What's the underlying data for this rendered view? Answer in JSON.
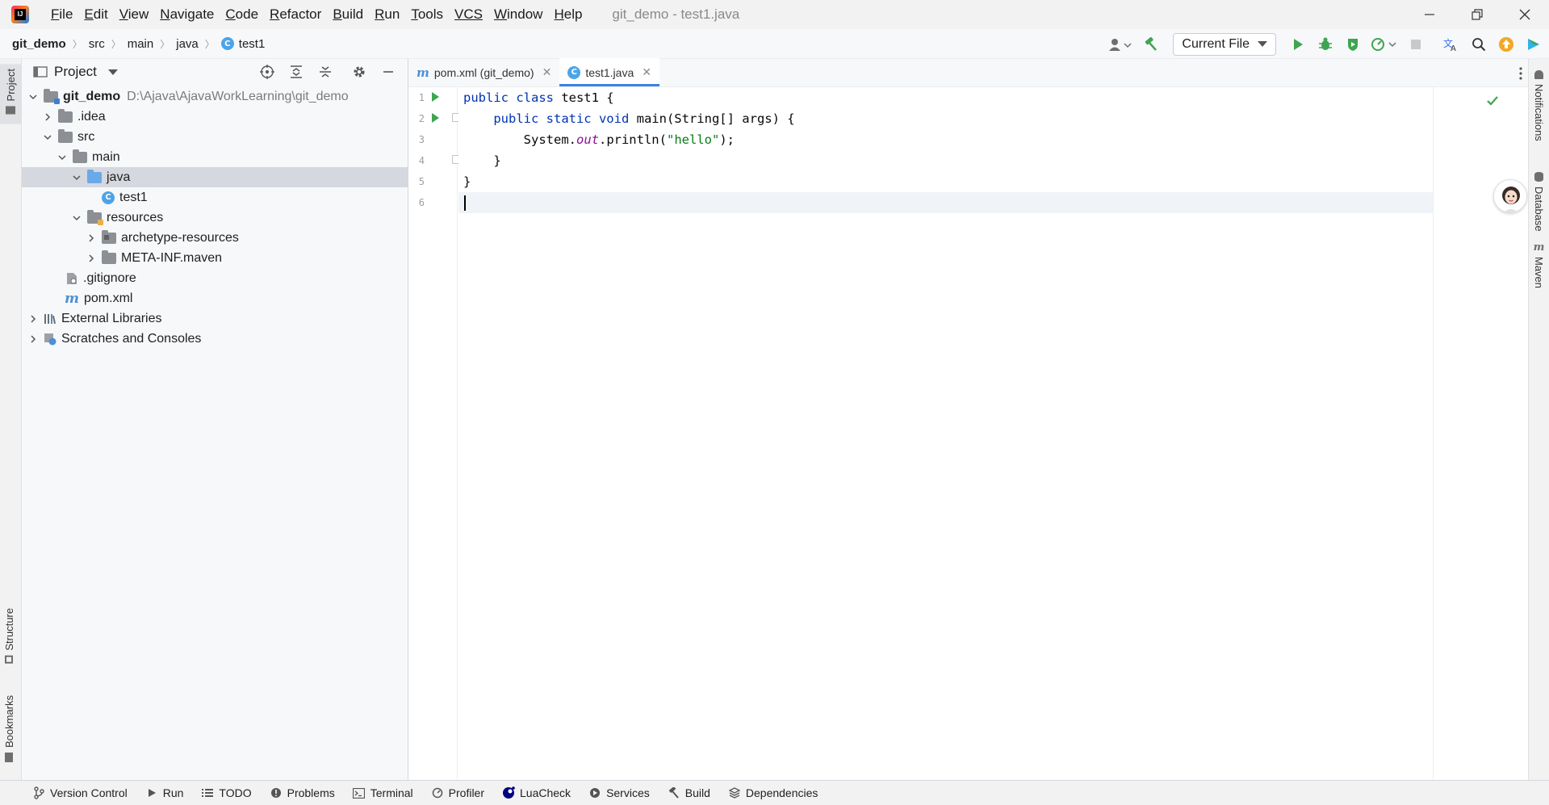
{
  "window": {
    "title": "git_demo - test1.java"
  },
  "menu": [
    {
      "underline": "F",
      "rest": "ile"
    },
    {
      "underline": "E",
      "rest": "dit"
    },
    {
      "underline": "V",
      "rest": "iew"
    },
    {
      "underline": "N",
      "rest": "avigate"
    },
    {
      "underline": "C",
      "rest": "ode"
    },
    {
      "underline": "R",
      "rest": "efactor"
    },
    {
      "underline": "B",
      "rest": "uild"
    },
    {
      "underline": "R",
      "rest": "un"
    },
    {
      "underline": "T",
      "rest": "ools"
    },
    {
      "underline": "VCS",
      "rest": ""
    },
    {
      "underline": "W",
      "rest": "indow"
    },
    {
      "underline": "H",
      "rest": "elp"
    }
  ],
  "breadcrumb": [
    "git_demo",
    "src",
    "main",
    "java",
    "test1"
  ],
  "toolbar": {
    "run_config": "Current File"
  },
  "project_panel": {
    "title": "Project",
    "tree": [
      {
        "label": "git_demo",
        "path": "D:\\Ajava\\AjavaWorkLearning\\git_demo"
      },
      {
        "label": ".idea"
      },
      {
        "label": "src"
      },
      {
        "label": "main"
      },
      {
        "label": "java"
      },
      {
        "label": "test1"
      },
      {
        "label": "resources"
      },
      {
        "label": "archetype-resources"
      },
      {
        "label": "META-INF.maven"
      },
      {
        "label": ".gitignore"
      },
      {
        "label": "pom.xml"
      },
      {
        "label": "External Libraries"
      },
      {
        "label": "Scratches and Consoles"
      }
    ]
  },
  "editor": {
    "tabs": [
      {
        "label": "pom.xml (git_demo)",
        "active": false
      },
      {
        "label": "test1.java",
        "active": true
      }
    ],
    "line_numbers": [
      "1",
      "2",
      "3",
      "4",
      "5",
      "6"
    ],
    "code": {
      "l1_kw": "public class",
      "l1_rest": " test1 {",
      "l2_indent": "    ",
      "l2_kw": "public static void",
      "l2_rest": " main(String[] args) {",
      "l3_indent": "        ",
      "l3_a": "System.",
      "l3_field": "out",
      "l3_b": ".println(",
      "l3_str": "\"hello\"",
      "l3_c": ");",
      "l4": "    }",
      "l5": "}"
    },
    "current_line": 6
  },
  "left_stripe": [
    "Project",
    "Structure",
    "Bookmarks"
  ],
  "right_stripe": [
    "Notifications",
    "Database",
    "Maven"
  ],
  "bottom_tabs": [
    "Version Control",
    "Run",
    "TODO",
    "Problems",
    "Terminal",
    "Profiler",
    "LuaCheck",
    "Services",
    "Build",
    "Dependencies"
  ],
  "colors": {
    "accent": "#3b82e0",
    "run_green": "#3ea552",
    "keyword": "#0033b3",
    "string": "#067d17",
    "field": "#871094"
  }
}
